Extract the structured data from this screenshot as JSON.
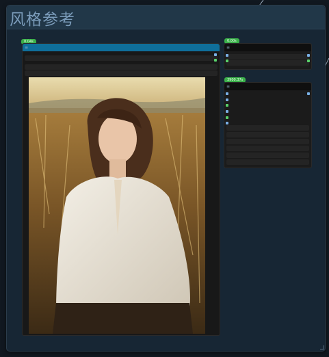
{
  "group": {
    "title": "风格参考"
  },
  "nodes": {
    "image_loader": {
      "badge": "0.04s",
      "menu_icon": "menu-icon"
    },
    "mid_node": {
      "badge": "0.00s",
      "menu_icon": "menu-icon"
    },
    "right_node": {
      "badge": "3900.37s",
      "menu_icon": "menu-icon"
    }
  },
  "colors": {
    "group_bg": "#172634",
    "header_bg": "#213748",
    "title": "#7b9cba",
    "badge": "#3bb04a",
    "node_header_blue": "#0f6f9b",
    "socket_blue": "#7ab0e6",
    "socket_green": "#59d16a"
  }
}
